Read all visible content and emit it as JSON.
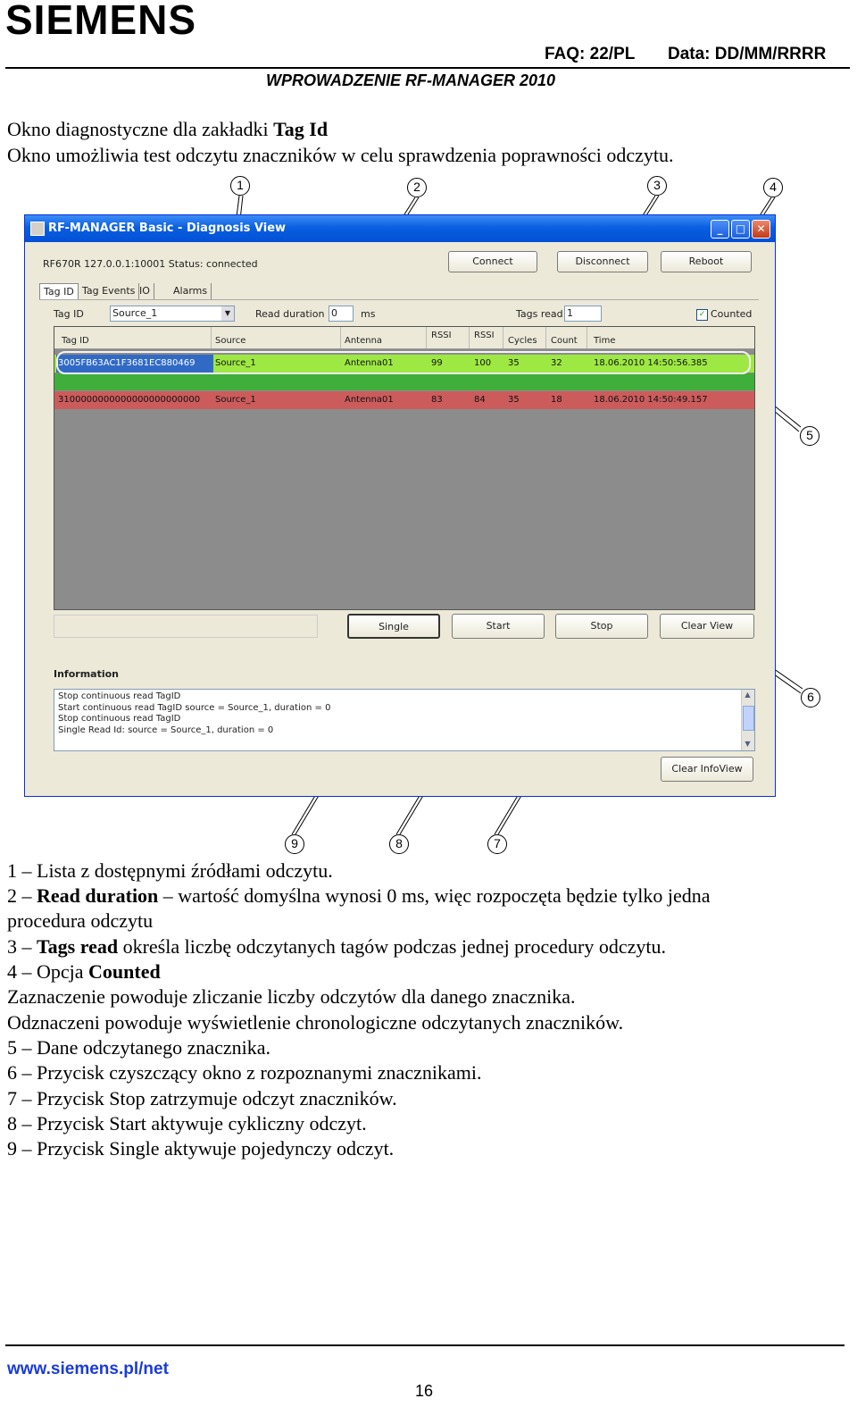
{
  "header": {
    "logo": "SIEMENS",
    "faq": "FAQ: 22/PL",
    "date": "Data: DD/MM/RRRR",
    "subtitle": "WPROWADZENIE RF-MANAGER 2010"
  },
  "intro": {
    "line1_prefix": "Okno diagnostyczne dla zakładki ",
    "line1_bold": "Tag Id",
    "line2": "Okno umożliwia test odczytu znaczników w celu sprawdzenia poprawności odczytu."
  },
  "window": {
    "title": "RF-MANAGER Basic - Diagnosis View",
    "status_line": "RF670R   127.0.0.1:10001  Status: connected",
    "buttons": {
      "connect": "Connect",
      "disconnect": "Disconnect",
      "reboot": "Reboot"
    },
    "tabs": [
      "Tag ID",
      "Tag Events",
      "IO",
      "Alarms"
    ],
    "tag_id_label": "Tag ID",
    "source_value": "Source_1",
    "read_duration_label": "Read duration",
    "read_duration_value": "0",
    "ms_label": "ms",
    "tags_read_label": "Tags read",
    "tags_read_value": "1",
    "counted_label": "Counted",
    "counted_checked": true,
    "table": {
      "headers": [
        "Tag ID",
        "Source",
        "Antenna",
        "RSSI",
        "RSSI",
        "Cycles",
        "Count",
        "Time"
      ],
      "rows": [
        {
          "tag": "3005FB63AC1F3681EC880469",
          "source": "Source_1",
          "antenna": "Antenna01",
          "rssi1": "99",
          "rssi2": "100",
          "cycles": "35",
          "count": "32",
          "time": "18.06.2010 14:50:56.385",
          "color": "#9ee843"
        },
        {
          "tag": "3100000000000000000000000",
          "source": "Source_1",
          "antenna": "Antenna01",
          "rssi1": "83",
          "rssi2": "84",
          "cycles": "35",
          "count": "18",
          "time": "18.06.2010 14:50:49.157",
          "color": "#cc5c5c"
        }
      ]
    },
    "action_buttons": {
      "single": "Single",
      "start": "Start",
      "stop": "Stop",
      "clear": "Clear View"
    },
    "information_label": "Information",
    "info_lines": [
      "Stop continuous read TagID",
      "Start continuous read TagID source = Source_1, duration = 0",
      "Stop continuous read TagID",
      "Single Read Id:  source = Source_1, duration = 0"
    ],
    "clear_info_button": "Clear InfoView"
  },
  "callouts": [
    "1",
    "2",
    "3",
    "4",
    "5",
    "6",
    "7",
    "8",
    "9"
  ],
  "legend": {
    "l1": "1 – Lista z dostępnymi źródłami odczytu.",
    "l2_prefix": "2 – ",
    "l2_bold": "Read duration",
    "l2_rest": " – wartość domyślna wynosi 0 ms, więc rozpoczęta będzie tylko jedna",
    "l2_cont": "procedura odczytu",
    "l3_prefix": "3 – ",
    "l3_bold": "Tags read",
    "l3_rest": " określa liczbę odczytanych tagów podczas jednej procedury odczytu.",
    "l4_prefix": "4 – Opcja ",
    "l4_bold": "Counted",
    "l4_a": "Zaznaczenie powoduje zliczanie liczby odczytów dla danego znacznika.",
    "l4_b": "Odznaczeni powoduje wyświetlenie chronologiczne odczytanych znaczników.",
    "l5": "5 – Dane odczytanego znacznika.",
    "l6": "6 – Przycisk czyszczący okno z rozpoznanymi znacznikami.",
    "l7": "7 – Przycisk Stop zatrzymuje odczyt znaczników.",
    "l8": "8 – Przycisk Start aktywuje cykliczny odczyt.",
    "l9": "9 – Przycisk Single aktywuje pojedynczy odczyt."
  },
  "footer": {
    "url": "www.siemens.pl/net",
    "page": "16"
  }
}
